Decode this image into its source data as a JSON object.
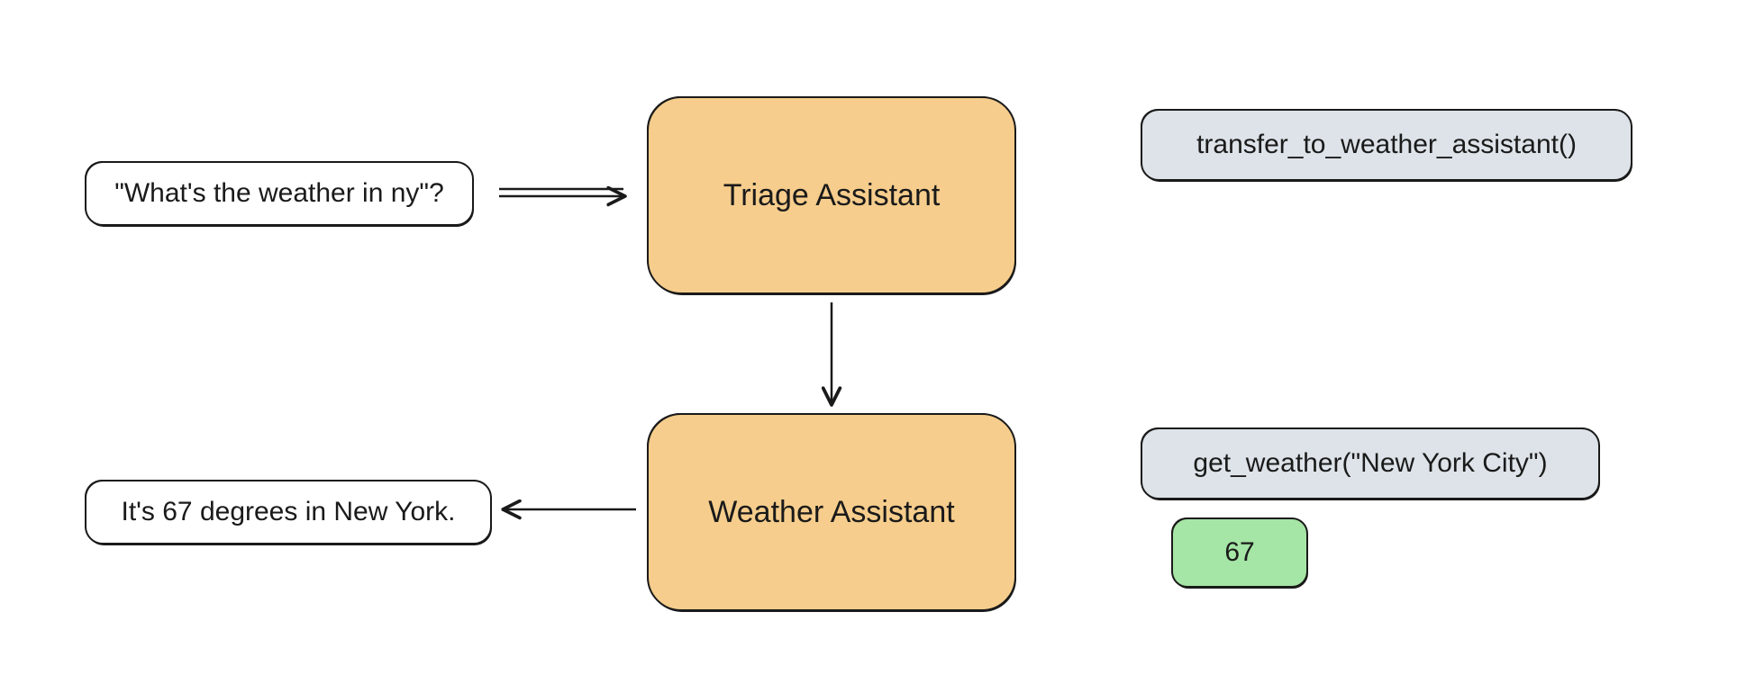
{
  "nodes": {
    "user_query": {
      "text": "\"What's the weather in ny\"?"
    },
    "triage_agent": {
      "text": "Triage Assistant"
    },
    "transfer_call": {
      "text": "transfer_to_weather_assistant()"
    },
    "weather_agent": {
      "text": "Weather Assistant"
    },
    "get_weather_call": {
      "text": "get_weather(\"New York City\")"
    },
    "weather_result": {
      "text": "67"
    },
    "final_answer": {
      "text": "It's 67 degrees in New York."
    }
  },
  "colors": {
    "agent_fill": "#f6cd8c",
    "tool_fill": "#dde3e8",
    "result_fill": "#a5e5a5",
    "stroke": "#1a1a1a"
  },
  "arrows": [
    {
      "from": "user_query",
      "to": "triage_agent",
      "style": "double"
    },
    {
      "from": "triage_agent",
      "to": "weather_agent",
      "style": "single"
    },
    {
      "from": "weather_agent",
      "to": "final_answer",
      "style": "single"
    }
  ]
}
